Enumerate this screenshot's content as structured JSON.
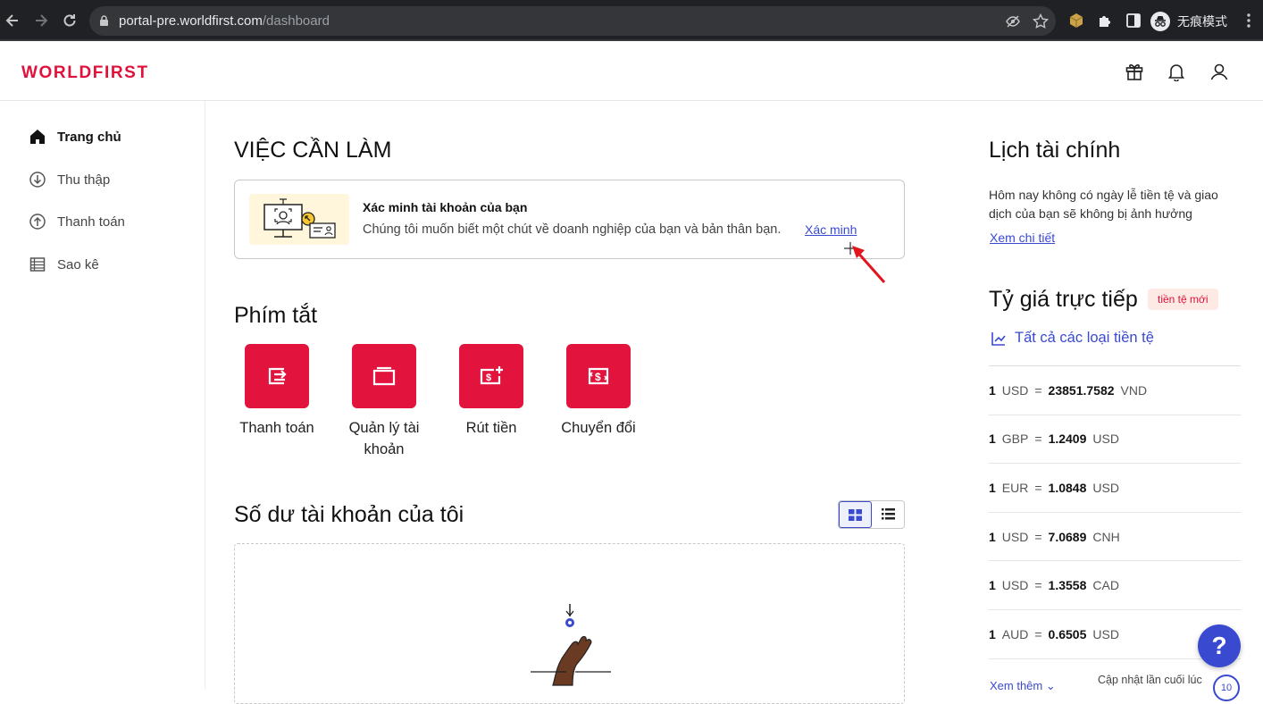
{
  "browser": {
    "url_host": "portal-pre.worldfirst.com",
    "url_path": "/dashboard",
    "incognito_label": "无痕模式"
  },
  "header": {
    "logo": "WORLDFIRST"
  },
  "sidebar": {
    "items": [
      {
        "label": "Trang chủ",
        "icon": "home-icon",
        "active": true
      },
      {
        "label": "Thu thập",
        "icon": "collect-icon"
      },
      {
        "label": "Thanh toán",
        "icon": "pay-icon"
      },
      {
        "label": "Sao kê",
        "icon": "statement-icon"
      }
    ]
  },
  "todo": {
    "heading": "VIỆC CẦN LÀM",
    "card_title": "Xác minh tài khoản của bạn",
    "card_desc": "Chúng tôi muốn biết một chút về doanh nghiệp của bạn và bản thân bạn.",
    "action": "Xác minh"
  },
  "shortcuts": {
    "heading": "Phím tắt",
    "items": [
      {
        "label": "Thanh toán",
        "icon": "transfer-icon"
      },
      {
        "label": "Quản lý tài khoản",
        "icon": "folder-icon"
      },
      {
        "label": "Rút tiền",
        "icon": "withdraw-icon"
      },
      {
        "label": "Chuyển đổi",
        "icon": "exchange-icon"
      }
    ]
  },
  "balance": {
    "heading": "Số dư tài khoản của tôi"
  },
  "calendar": {
    "heading": "Lịch tài chính",
    "text": "Hôm nay không có ngày lễ tiền tệ và giao dịch của bạn sẽ không bị ảnh hưởng",
    "link": "Xem chi tiết"
  },
  "rates": {
    "heading": "Tỷ giá trực tiếp",
    "badge": "tiền tệ mới",
    "all_link": "Tất cả các loại tiền tệ",
    "items": [
      {
        "amount": "1",
        "from": "USD",
        "eq": "=",
        "value": "23851.7582",
        "to": "VND"
      },
      {
        "amount": "1",
        "from": "GBP",
        "eq": "=",
        "value": "1.2409",
        "to": "USD"
      },
      {
        "amount": "1",
        "from": "EUR",
        "eq": "=",
        "value": "1.0848",
        "to": "USD"
      },
      {
        "amount": "1",
        "from": "USD",
        "eq": "=",
        "value": "7.0689",
        "to": "CNH"
      },
      {
        "amount": "1",
        "from": "USD",
        "eq": "=",
        "value": "1.3558",
        "to": "CAD"
      },
      {
        "amount": "1",
        "from": "AUD",
        "eq": "=",
        "value": "0.6505",
        "to": "USD"
      }
    ],
    "more": "Xem thêm",
    "updated": "Cập nhật lần cuối lúc",
    "count": "10"
  },
  "help": {
    "label": "?"
  },
  "colors": {
    "brand": "#e0113b",
    "link": "#3a4ad0"
  }
}
